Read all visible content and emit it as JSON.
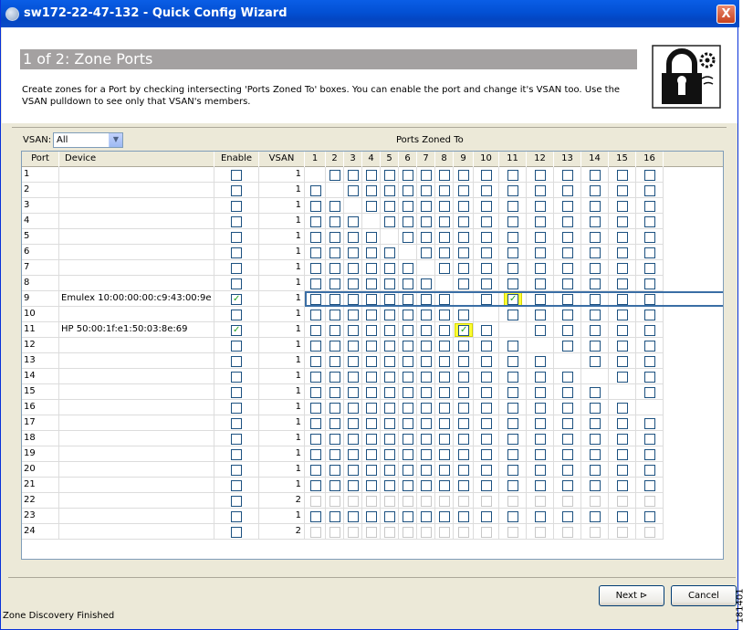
{
  "window": {
    "title": "sw172-22-47-132 - Quick Config Wizard",
    "close_label": "X"
  },
  "header": {
    "heading": "1 of 2: Zone Ports",
    "description": "Create zones for a Port by checking intersecting 'Ports Zoned To' boxes. You can enable the port and change it's VSAN too. Use the VSAN pulldown to see only that VSAN's members."
  },
  "filter": {
    "label": "VSAN:",
    "selected": "All",
    "ports_zoned_to_label": "Ports Zoned To"
  },
  "table": {
    "headers": {
      "port": "Port",
      "device": "Device",
      "enable": "Enable",
      "vsan": "VSAN"
    },
    "zone_columns": [
      "1",
      "2",
      "3",
      "4",
      "5",
      "6",
      "7",
      "8",
      "9",
      "10",
      "11",
      "12",
      "13",
      "14",
      "15",
      "16"
    ],
    "rows": [
      {
        "port": "1",
        "device": "",
        "enable": false,
        "vsan": "1"
      },
      {
        "port": "2",
        "device": "",
        "enable": false,
        "vsan": "1"
      },
      {
        "port": "3",
        "device": "",
        "enable": false,
        "vsan": "1"
      },
      {
        "port": "4",
        "device": "",
        "enable": false,
        "vsan": "1"
      },
      {
        "port": "5",
        "device": "",
        "enable": false,
        "vsan": "1"
      },
      {
        "port": "6",
        "device": "",
        "enable": false,
        "vsan": "1"
      },
      {
        "port": "7",
        "device": "",
        "enable": false,
        "vsan": "1"
      },
      {
        "port": "8",
        "device": "",
        "enable": false,
        "vsan": "1"
      },
      {
        "port": "9",
        "device": "Emulex 10:00:00:00:c9:43:00:9e",
        "enable": true,
        "vsan": "1"
      },
      {
        "port": "10",
        "device": "",
        "enable": false,
        "vsan": "1"
      },
      {
        "port": "11",
        "device": "HP 50:00:1f:e1:50:03:8e:69",
        "enable": true,
        "vsan": "1"
      },
      {
        "port": "12",
        "device": "",
        "enable": false,
        "vsan": "1"
      },
      {
        "port": "13",
        "device": "",
        "enable": false,
        "vsan": "1"
      },
      {
        "port": "14",
        "device": "",
        "enable": false,
        "vsan": "1"
      },
      {
        "port": "15",
        "device": "",
        "enable": false,
        "vsan": "1"
      },
      {
        "port": "16",
        "device": "",
        "enable": false,
        "vsan": "1"
      },
      {
        "port": "17",
        "device": "",
        "enable": false,
        "vsan": "1"
      },
      {
        "port": "18",
        "device": "",
        "enable": false,
        "vsan": "1"
      },
      {
        "port": "19",
        "device": "",
        "enable": false,
        "vsan": "1"
      },
      {
        "port": "20",
        "device": "",
        "enable": false,
        "vsan": "1"
      },
      {
        "port": "21",
        "device": "",
        "enable": false,
        "vsan": "1"
      },
      {
        "port": "22",
        "device": "",
        "enable": false,
        "vsan": "2"
      },
      {
        "port": "23",
        "device": "",
        "enable": false,
        "vsan": "1"
      },
      {
        "port": "24",
        "device": "",
        "enable": false,
        "vsan": "2"
      }
    ],
    "zoned_checked": [
      {
        "port": "9",
        "zoned_to": "11"
      },
      {
        "port": "11",
        "zoned_to": "9"
      }
    ],
    "selected_port": "9"
  },
  "buttons": {
    "next": "Next",
    "cancel": "Cancel"
  },
  "status": "Zone Discovery Finished",
  "figure_id": "181401"
}
